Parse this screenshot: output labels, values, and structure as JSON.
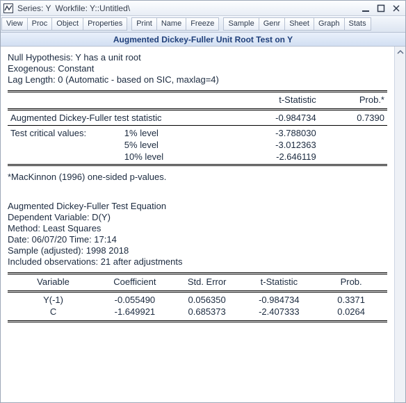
{
  "titlebar": {
    "series_label": "Series: Y",
    "workfile_label": "Workfile: Y::Untitled\\"
  },
  "toolbar": {
    "groups": [
      [
        "View",
        "Proc",
        "Object",
        "Properties"
      ],
      [
        "Print",
        "Name",
        "Freeze"
      ],
      [
        "Sample",
        "Genr",
        "Sheet",
        "Graph",
        "Stats"
      ]
    ]
  },
  "subtitle": "Augmented Dickey-Fuller Unit Root Test on Y",
  "hypothesis": {
    "null": "Null Hypothesis: Y has a unit root",
    "exog": "Exogenous: Constant",
    "lag": "Lag Length: 0 (Automatic - based on SIC, maxlag=4)"
  },
  "test_table": {
    "headers": {
      "tstat": "t-Statistic",
      "prob": "Prob.*"
    },
    "adf_row": {
      "label": "Augmented Dickey-Fuller test statistic",
      "t": "-0.984734",
      "p": "0.7390"
    },
    "crit_label": "Test critical values:",
    "crit": [
      {
        "level": "1% level",
        "value": "-3.788030"
      },
      {
        "level": "5% level",
        "value": "-3.012363"
      },
      {
        "level": "10% level",
        "value": "-2.646119"
      }
    ]
  },
  "note": "*MacKinnon (1996) one-sided p-values.",
  "equation_header": {
    "l1": "Augmented Dickey-Fuller Test Equation",
    "l2": "Dependent Variable: D(Y)",
    "l3": "Method: Least Squares",
    "l4": "Date: 06/07/20   Time: 17:14",
    "l5": "Sample (adjusted): 1998 2018",
    "l6": "Included observations: 21 after adjustments"
  },
  "coef_table": {
    "headers": {
      "var": "Variable",
      "coef": "Coefficient",
      "se": "Std. Error",
      "t": "t-Statistic",
      "p": "Prob."
    },
    "rows": [
      {
        "var": "Y(-1)",
        "coef": "-0.055490",
        "se": "0.056350",
        "t": "-0.984734",
        "p": "0.3371"
      },
      {
        "var": "C",
        "coef": "-1.649921",
        "se": "0.685373",
        "t": "-2.407333",
        "p": "0.0264"
      }
    ]
  }
}
